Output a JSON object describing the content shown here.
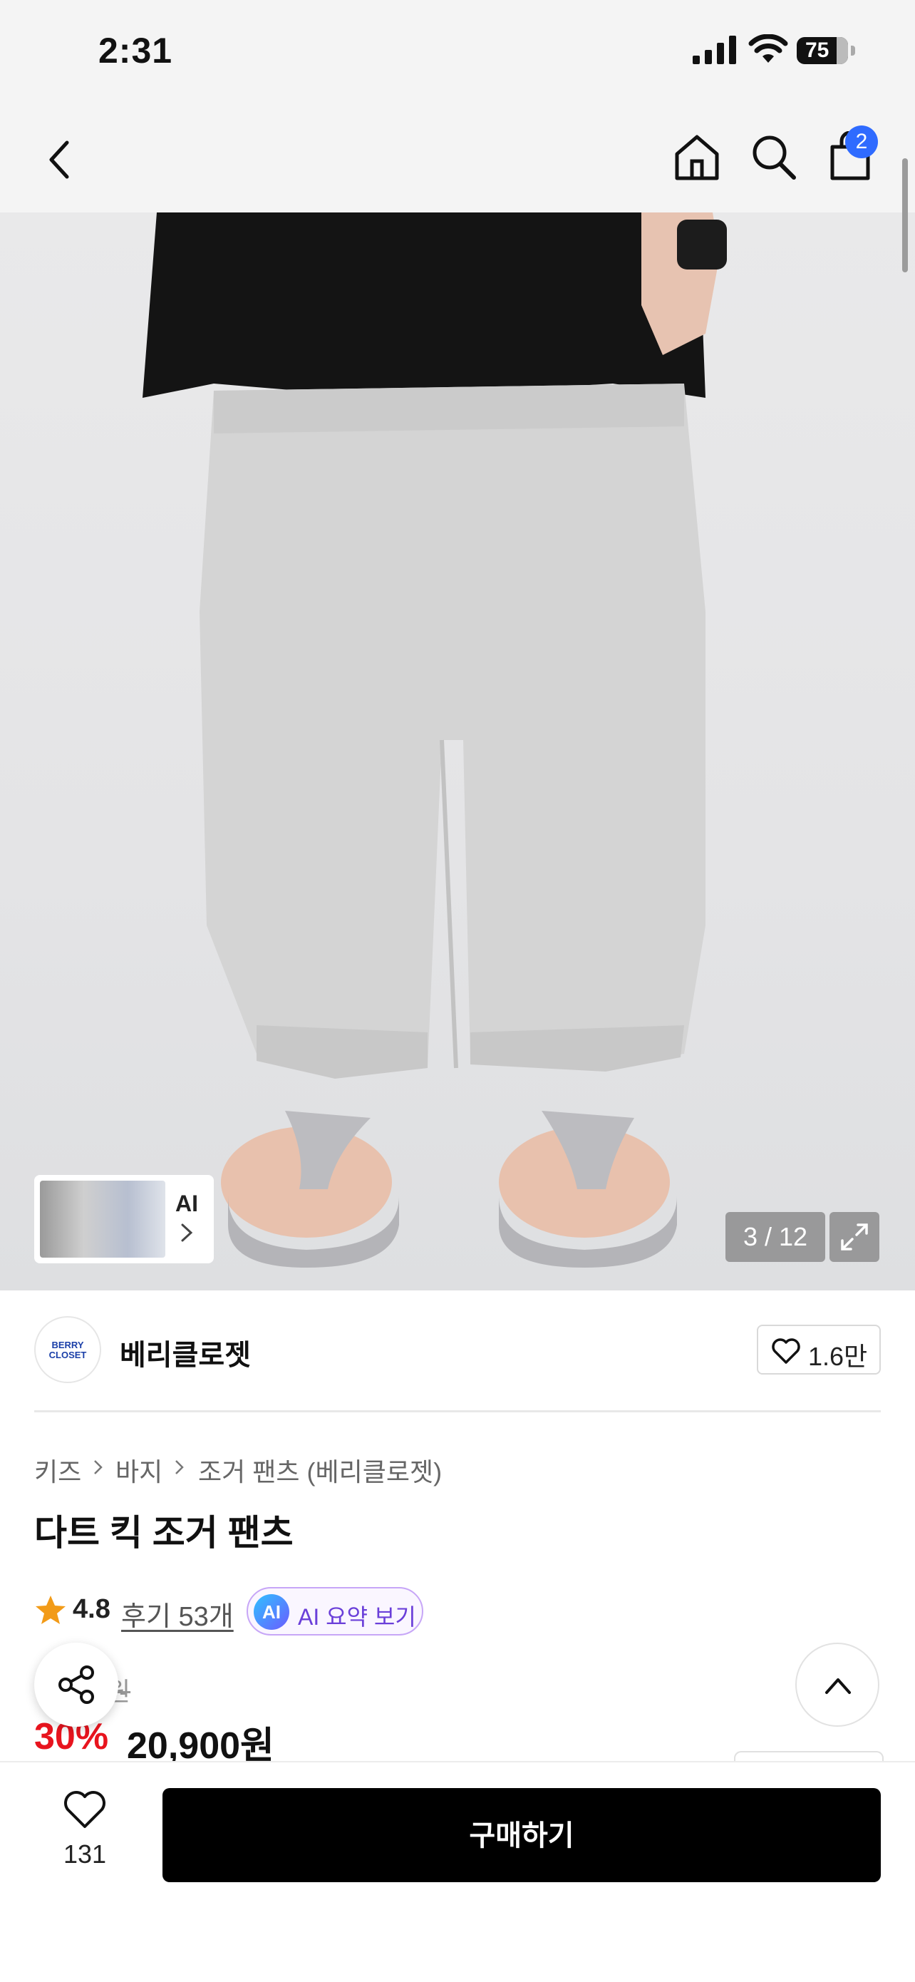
{
  "status_bar": {
    "time": "2:31",
    "battery": "75"
  },
  "nav": {
    "cart_count": "2"
  },
  "gallery": {
    "ai_label": "AI",
    "counter": "3 / 12"
  },
  "brand": {
    "logo_line1": "BERRY",
    "logo_line2": "CLOSET",
    "name": "베리클로젯",
    "likes": "1.6만"
  },
  "breadcrumb": [
    "키즈",
    "바지",
    "조거 팬츠 (베리클로젯)"
  ],
  "product": {
    "title": "다트 킥 조거 팬츠",
    "rating": "4.8",
    "reviews": "후기 53개",
    "ai_summary_badge": "AI",
    "ai_summary_label": "AI 요약 보기",
    "original_price": "원",
    "discount": "30%",
    "price": "20,900원"
  },
  "bottom": {
    "wish_count": "131",
    "buy_label": "구매하기"
  },
  "colors": {
    "accent_blue": "#2f6bff",
    "discount_red": "#e8141e",
    "buy_button": "#000000",
    "star": "#f29b18",
    "ai_purple": "#6a3fd9"
  }
}
